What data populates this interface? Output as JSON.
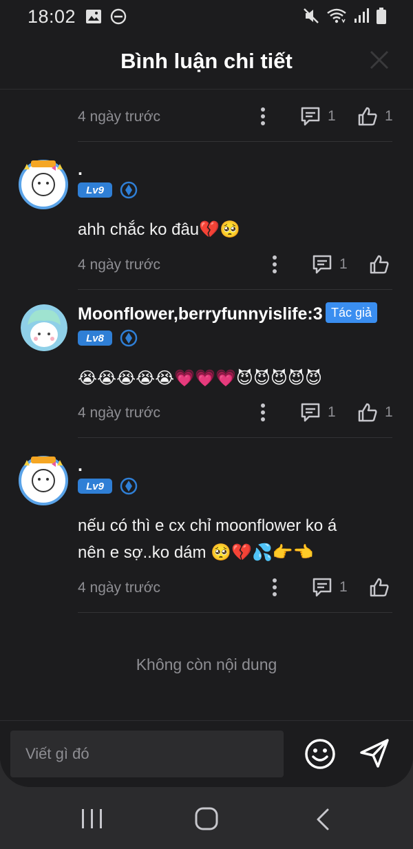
{
  "status_bar": {
    "time": "18:02"
  },
  "header": {
    "title": "Bình luận chi tiết"
  },
  "comments": [
    {
      "time": "4 ngày trước",
      "reply_count": "1",
      "like_count": "1"
    },
    {
      "username": ".",
      "level": "Lv9",
      "text": "ahh chắc ko đâu💔🥺",
      "time": "4 ngày trước",
      "reply_count": "1"
    },
    {
      "username": "Moonflower,berryfunnyislife:3",
      "author_tag": "Tác giả",
      "level": "Lv8",
      "text": "😭😭😭😭😭💗💗💗😈😈😈😈😈",
      "time": "4 ngày trước",
      "reply_count": "1",
      "like_count": "1"
    },
    {
      "username": ".",
      "level": "Lv9",
      "text_line1": "nếu có thì e cx chỉ moonflower ko á",
      "text_line2": "nên e sợ..ko dám 🥺💔💦👉👈",
      "time": "4 ngày trước",
      "reply_count": "1"
    }
  ],
  "list_end": "Không còn nội dung",
  "composer": {
    "placeholder": "Viết gì đó"
  },
  "colors": {
    "accent": "#2f7fd6",
    "author_tag": "#3a8ef0",
    "background": "#1c1c1e"
  },
  "icons": [
    "image-icon",
    "dnd-icon",
    "mute-icon",
    "wifi-icon",
    "signal-icon",
    "battery-icon",
    "close-icon",
    "more-icon",
    "reply-icon",
    "like-icon",
    "rank-icon",
    "emoji-icon",
    "send-icon"
  ]
}
